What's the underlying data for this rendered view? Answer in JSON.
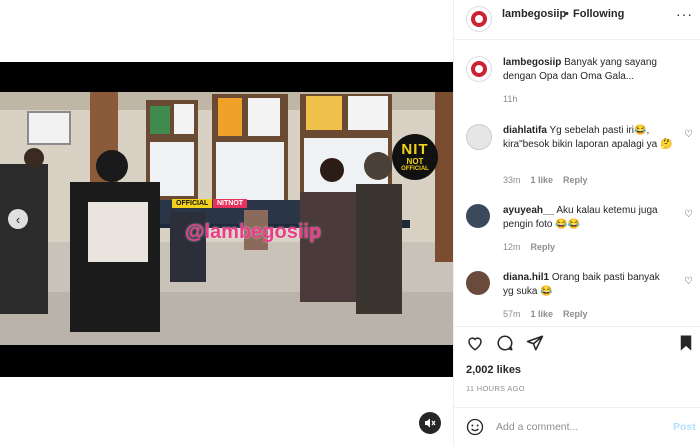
{
  "post": {
    "username": "lambegosiip",
    "separator": "•",
    "follow_status": "Following",
    "more_icon": "ellipsis-icon",
    "caption": "Banyak yang sayang dengan Opa dan Oma Gala...",
    "caption_age": "11h"
  },
  "video": {
    "watermark_handle": "@lambegosiip",
    "tag_official": "OFFICIAL",
    "tag_nitnot": "NITNOT",
    "logo_big": "NIT",
    "logo_mid": "NOT",
    "logo_small": "OFFICIAL",
    "prev_icon": "chevron-left-icon",
    "mute_icon": "speaker-muted-icon"
  },
  "comments": [
    {
      "user": "diahlatifa",
      "text": "Yg sebelah pasti iri😂, kira\"besok bikin laporan apalagi ya 🤔",
      "age": "33m",
      "likes": "1 like",
      "reply": "Reply"
    },
    {
      "user": "ayuyeah__",
      "text": "Aku kalau ketemu juga pengin foto 😂😂",
      "age": "12m",
      "likes": "",
      "reply": "Reply"
    },
    {
      "user": "diana.hil1",
      "text": "Orang baik pasti banyak yg suka 😂",
      "age": "57m",
      "likes": "1 like",
      "reply": "Reply"
    }
  ],
  "actions": {
    "likes": "2,002 likes",
    "time": "11 HOURS AGO",
    "add_comment_placeholder": "Add a comment...",
    "post_label": "Post",
    "emoji_icon": "smiley-icon"
  },
  "colors": {
    "accent_disabled": "#b2dffc",
    "watermark_pink": "#e83e8c",
    "logo_yellow": "#f3d21b"
  }
}
